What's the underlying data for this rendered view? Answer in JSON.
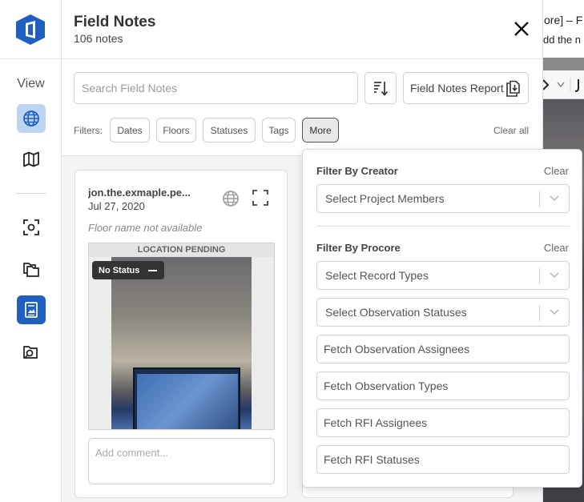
{
  "rail": {
    "view_label": "View"
  },
  "header": {
    "title": "Field Notes",
    "count": "106 notes"
  },
  "toolbar": {
    "search_placeholder": "Search Field Notes",
    "report_label": "Field Notes Report"
  },
  "filters": {
    "label": "Filters:",
    "chips": [
      "Dates",
      "Floors",
      "Statuses",
      "Tags",
      "More"
    ],
    "clear_all": "Clear all"
  },
  "note_card": {
    "author": "jon.the.exmaple.pe...",
    "date": "Jul 27, 2020",
    "floor": "Floor name not available",
    "location_banner": "LOCATION PENDING",
    "status": "No Status",
    "comment_placeholder": "Add comment..."
  },
  "background_app": {
    "line1": "ore] – F",
    "line2": "dd the n"
  },
  "more_filters": {
    "creator_title": "Filter By Creator",
    "creator_clear": "Clear",
    "creator_select": "Select Project Members",
    "procore_title": "Filter By Procore",
    "procore_clear": "Clear",
    "record_types": "Select Record Types",
    "observation_statuses": "Select Observation Statuses",
    "fetch_items": [
      "Fetch Observation Assignees",
      "Fetch Observation Types",
      "Fetch RFI Assignees",
      "Fetch RFI Statuses"
    ]
  },
  "colors": {
    "accent": "#1f5fbf",
    "accent_light": "#bcd3f2"
  }
}
